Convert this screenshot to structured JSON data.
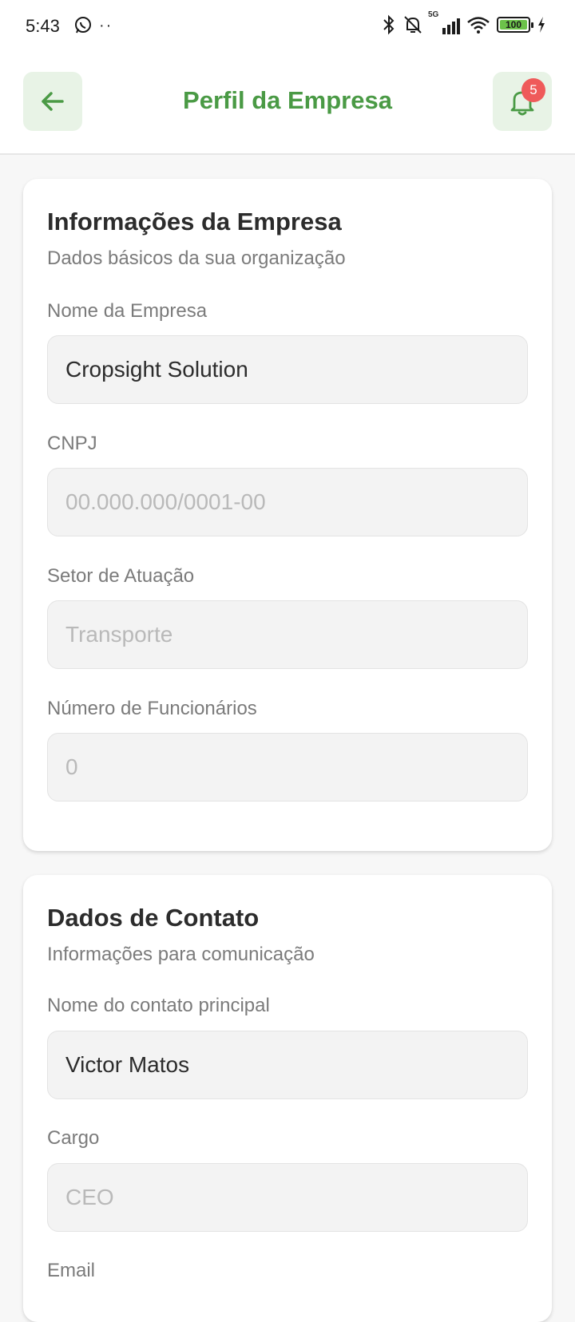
{
  "status_bar": {
    "time": "5:43",
    "network": "5G",
    "battery": "100"
  },
  "header": {
    "title": "Perfil da Empresa",
    "notification_count": "5"
  },
  "company_card": {
    "title": "Informações da Empresa",
    "subtitle": "Dados básicos da sua organização",
    "fields": [
      {
        "label": "Nome da Empresa",
        "value": "Cropsight Solution",
        "placeholder": ""
      },
      {
        "label": "CNPJ",
        "value": "",
        "placeholder": "00.000.000/0001-00"
      },
      {
        "label": "Setor de Atuação",
        "value": "",
        "placeholder": "Transporte"
      },
      {
        "label": "Número de Funcionários",
        "value": "",
        "placeholder": "0"
      }
    ]
  },
  "contact_card": {
    "title": "Dados de Contato",
    "subtitle": "Informações para comunicação",
    "fields": [
      {
        "label": "Nome do contato principal",
        "value": "Victor  Matos",
        "placeholder": ""
      },
      {
        "label": "Cargo",
        "value": "",
        "placeholder": "CEO"
      },
      {
        "label": "Email",
        "value": "",
        "placeholder": ""
      }
    ]
  },
  "colors": {
    "accent": "#4a9a45",
    "accent_bg": "#e8f3e6",
    "badge": "#ef5a5a",
    "field_bg": "#f3f3f3"
  }
}
